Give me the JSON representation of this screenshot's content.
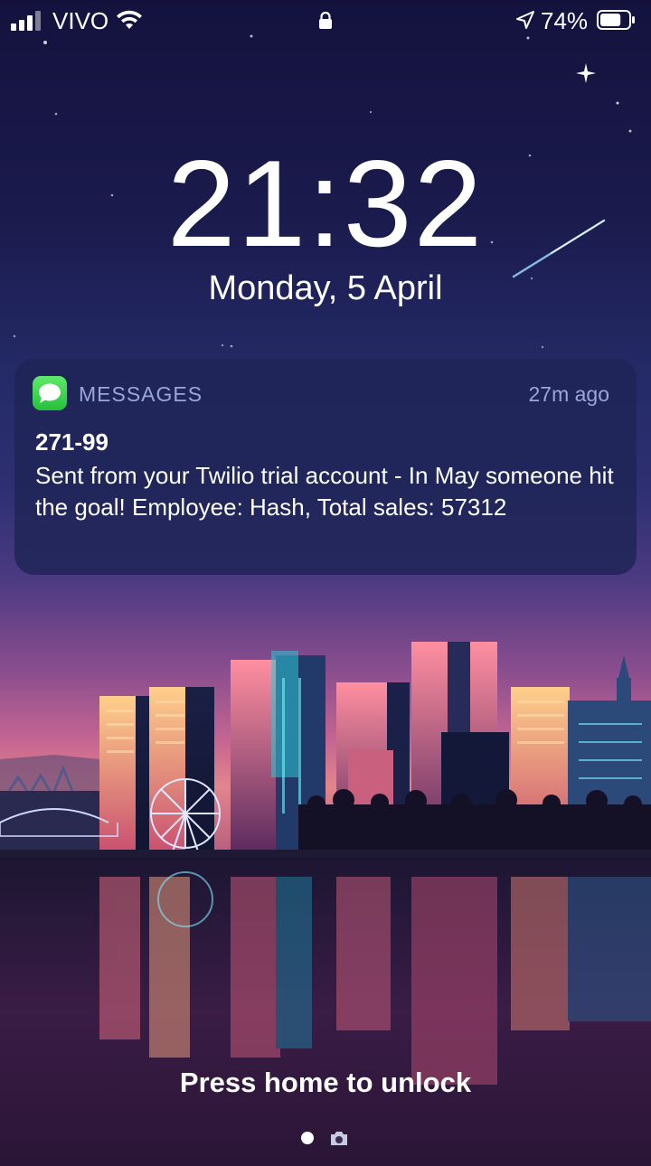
{
  "status_bar": {
    "carrier": "VIVO",
    "battery_percent": "74%",
    "battery_level": 0.74,
    "icons": [
      "signal-icon",
      "wifi-icon",
      "lock-icon",
      "location-icon",
      "battery-icon"
    ]
  },
  "lockscreen": {
    "time": "21:32",
    "date": "Monday, 5 April",
    "unlock_hint": "Press home to unlock"
  },
  "notification": {
    "app_name": "MESSAGES",
    "time_ago": "27m ago",
    "sender": "271-99",
    "body": "Sent from your Twilio trial account - In May someone hit the goal! Employee: Hash, Total sales: 57312",
    "app_icon": "messages-icon",
    "app_color": "#34c759"
  },
  "page_indicator": {
    "icons": [
      "page-dot-icon",
      "camera-icon"
    ]
  }
}
